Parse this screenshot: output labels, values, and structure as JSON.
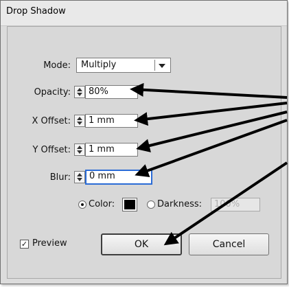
{
  "window": {
    "title": "Drop Shadow"
  },
  "mode": {
    "label": "Mode:",
    "value": "Multiply"
  },
  "opacity": {
    "label": "Opacity:",
    "value": "80%"
  },
  "x_offset": {
    "label": "X Offset:",
    "value": "1 mm"
  },
  "y_offset": {
    "label": "Y Offset:",
    "value": "1 mm"
  },
  "blur": {
    "label": "Blur:",
    "value": "0 mm"
  },
  "color_option": {
    "label": "Color:",
    "swatch_color": "#000000",
    "selected": true
  },
  "darkness_option": {
    "label": "Darkness:",
    "value": "100%",
    "selected": false
  },
  "preview": {
    "label": "Preview",
    "checked": true
  },
  "buttons": {
    "ok": "OK",
    "cancel": "Cancel"
  },
  "colors": {
    "focus": "#2a6bd6",
    "annotation_arrow": "#000000",
    "dialog_bg": "#d8d8d8"
  }
}
